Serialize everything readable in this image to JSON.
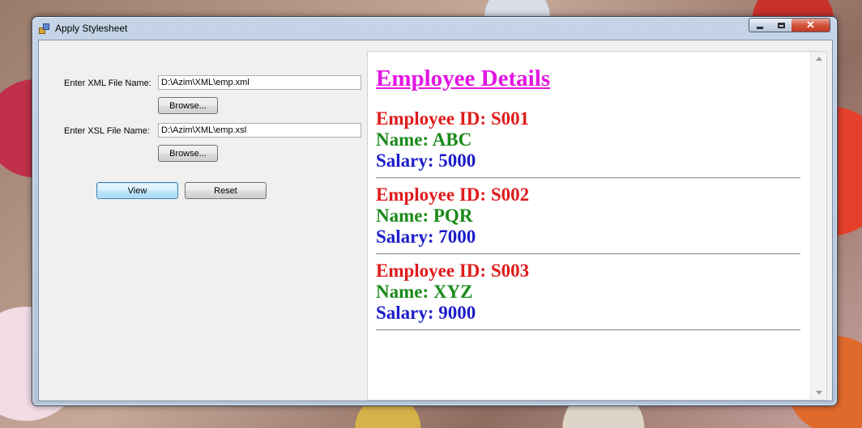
{
  "window": {
    "title": "Apply Stylesheet"
  },
  "form": {
    "xml_label": "Enter XML File Name:",
    "xml_value": "D:\\Azim\\XML\\emp.xml",
    "xml_browse": "Browse...",
    "xsl_label": "Enter XSL File Name:",
    "xsl_value": "D:\\Azim\\XML\\emp.xsl",
    "xsl_browse": "Browse...",
    "view_button": "View",
    "reset_button": "Reset"
  },
  "browser": {
    "heading": "Employee Details",
    "employees": [
      {
        "id": "Employee ID: S001",
        "name": "Name: ABC",
        "salary": "Salary: 5000"
      },
      {
        "id": "Employee ID: S002",
        "name": "Name: PQR",
        "salary": "Salary: 7000"
      },
      {
        "id": "Employee ID: S003",
        "name": "Name: XYZ",
        "salary": "Salary: 9000"
      }
    ]
  },
  "colors": {
    "heading": "#e215e2",
    "id": "#e01b1b",
    "name": "#1a8a1a",
    "salary": "#1c1ccc"
  }
}
